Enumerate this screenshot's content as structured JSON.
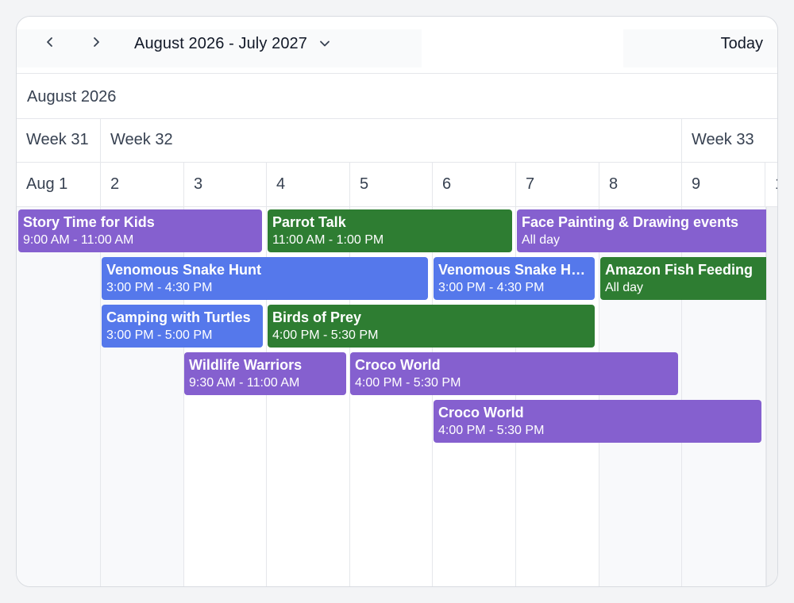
{
  "toolbar": {
    "prev_icon": "chevron-left-icon",
    "next_icon": "chevron-right-icon",
    "range_title": "August 2026 - July 2027",
    "range_caret_icon": "chevron-down-icon",
    "today_label": "Today"
  },
  "month_label": "August 2026",
  "weeks": [
    "Week 31",
    "Week 32",
    "Week 33"
  ],
  "days": [
    "Aug 1",
    "2",
    "3",
    "4",
    "5",
    "6",
    "7",
    "8",
    "9",
    "1"
  ],
  "events": [
    {
      "title": "Story Time for Kids",
      "time": "9:00 AM - 11:00 AM",
      "color": "#8560cf"
    },
    {
      "title": "Parrot Talk",
      "time": "11:00 AM - 1:00 PM",
      "color": "#2e7d32"
    },
    {
      "title": "Face Painting & Drawing events",
      "time": "All day",
      "color": "#8560cf"
    },
    {
      "title": "Venomous Snake Hunt",
      "time": "3:00 PM - 4:30 PM",
      "color": "#5578eb"
    },
    {
      "title": "Venomous Snake Hunt",
      "time": "3:00 PM - 4:30 PM",
      "color": "#5578eb"
    },
    {
      "title": "Amazon Fish Feeding",
      "time": "All day",
      "color": "#2e7d32"
    },
    {
      "title": "Camping with Turtles",
      "time": "3:00 PM - 5:00 PM",
      "color": "#5578eb"
    },
    {
      "title": "Birds of Prey",
      "time": "4:00 PM - 5:30 PM",
      "color": "#2e7d32"
    },
    {
      "title": "Wildlife Warriors",
      "time": "9:30 AM - 11:00 AM",
      "color": "#8560cf"
    },
    {
      "title": "Croco World",
      "time": "4:00 PM - 5:30 PM",
      "color": "#8560cf"
    },
    {
      "title": "Croco World",
      "time": "4:00 PM - 5:30 PM",
      "color": "#8560cf"
    }
  ],
  "colors": {
    "purple": "#8560cf",
    "green": "#2e7d32",
    "blue": "#5578eb"
  }
}
